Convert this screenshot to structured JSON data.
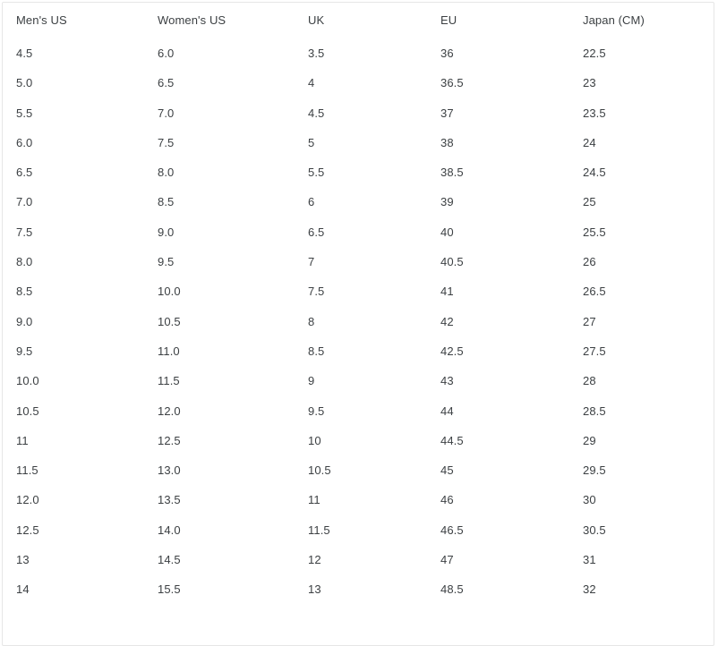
{
  "table": {
    "name": "shoe-size-conversion-chart",
    "columns": [
      {
        "key": "mens_us",
        "label": "Men's US"
      },
      {
        "key": "womens_us",
        "label": "Women's US"
      },
      {
        "key": "uk",
        "label": "UK"
      },
      {
        "key": "eu",
        "label": "EU"
      },
      {
        "key": "japan_cm",
        "label": "Japan (CM)"
      }
    ],
    "rows": [
      [
        "4.5",
        "6.0",
        "3.5",
        "36",
        "22.5"
      ],
      [
        "5.0",
        "6.5",
        "4",
        "36.5",
        "23"
      ],
      [
        "5.5",
        "7.0",
        "4.5",
        "37",
        "23.5"
      ],
      [
        "6.0",
        "7.5",
        "5",
        "38",
        "24"
      ],
      [
        "6.5",
        "8.0",
        "5.5",
        "38.5",
        "24.5"
      ],
      [
        "7.0",
        "8.5",
        "6",
        "39",
        "25"
      ],
      [
        "7.5",
        "9.0",
        "6.5",
        "40",
        "25.5"
      ],
      [
        "8.0",
        "9.5",
        "7",
        "40.5",
        "26"
      ],
      [
        "8.5",
        "10.0",
        "7.5",
        "41",
        "26.5"
      ],
      [
        "9.0",
        "10.5",
        "8",
        "42",
        "27"
      ],
      [
        "9.5",
        "11.0",
        "8.5",
        "42.5",
        "27.5"
      ],
      [
        "10.0",
        "11.5",
        "9",
        "43",
        "28"
      ],
      [
        "10.5",
        "12.0",
        "9.5",
        "44",
        "28.5"
      ],
      [
        "11",
        "12.5",
        "10",
        "44.5",
        "29"
      ],
      [
        "11.5",
        "13.0",
        "10.5",
        "45",
        "29.5"
      ],
      [
        "12.0",
        "13.5",
        "11",
        "46",
        "30"
      ],
      [
        "12.5",
        "14.0",
        "11.5",
        "46.5",
        "30.5"
      ],
      [
        "13",
        "14.5",
        "12",
        "47",
        "31"
      ],
      [
        "14",
        "15.5",
        "13",
        "48.5",
        "32"
      ]
    ]
  },
  "colors": {
    "text": "#3c4043",
    "border": "#e6e6e6",
    "background": "#ffffff"
  }
}
